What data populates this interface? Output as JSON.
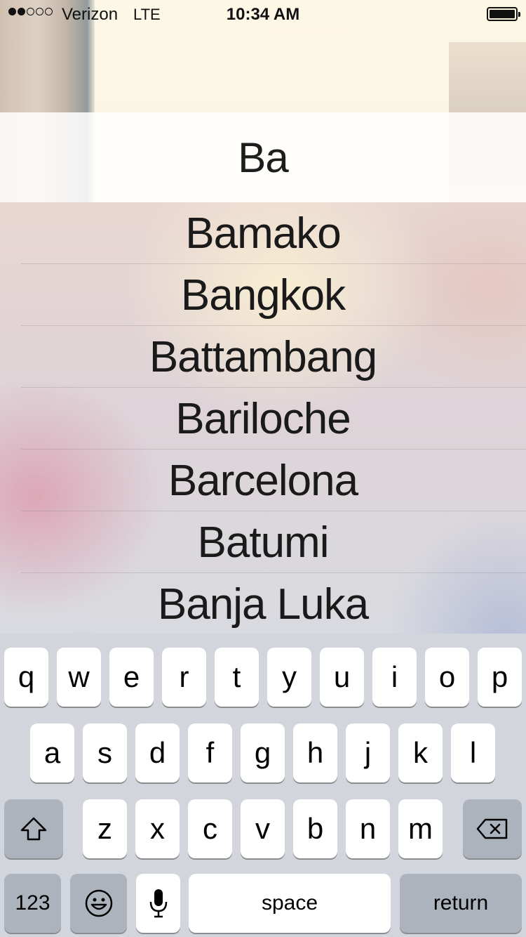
{
  "status_bar": {
    "carrier": "Verizon",
    "network": "LTE",
    "time": "10:34 AM",
    "signal_strength": 2,
    "signal_max": 5,
    "battery_level": 1.0
  },
  "search": {
    "value": "Ba"
  },
  "results": [
    "Bamako",
    "Bangkok",
    "Battambang",
    "Bariloche",
    "Barcelona",
    "Batumi",
    "Banja Luka"
  ],
  "keyboard": {
    "row1": [
      "q",
      "w",
      "e",
      "r",
      "t",
      "y",
      "u",
      "i",
      "o",
      "p"
    ],
    "row2": [
      "a",
      "s",
      "d",
      "f",
      "g",
      "h",
      "j",
      "k",
      "l"
    ],
    "row3": [
      "z",
      "x",
      "c",
      "v",
      "b",
      "n",
      "m"
    ],
    "shift_icon": "shift-icon",
    "delete_icon": "backspace-icon",
    "numbers_label": "123",
    "emoji_icon": "emoji-icon",
    "mic_icon": "microphone-icon",
    "space_label": "space",
    "return_label": "return"
  },
  "colors": {
    "keyboard_bg": "#d2d5db",
    "key_light": "#ffffff",
    "key_dark": "#adb3bc"
  }
}
